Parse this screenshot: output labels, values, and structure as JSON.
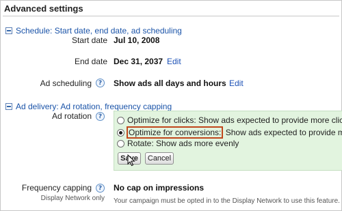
{
  "header": {
    "title": "Advanced settings"
  },
  "schedule": {
    "section_title": "Schedule: Start date, end date, ad scheduling",
    "start_date_label": "Start date",
    "start_date_value": "Jul 10, 2008",
    "end_date_label": "End date",
    "end_date_value": "Dec 31, 2037",
    "end_date_edit": "Edit",
    "ad_scheduling_label": "Ad scheduling",
    "ad_scheduling_value": "Show ads all days and hours",
    "ad_scheduling_edit": "Edit"
  },
  "delivery": {
    "section_title": "Ad delivery: Ad rotation, frequency capping",
    "ad_rotation_label": "Ad rotation",
    "options": [
      {
        "label": "Optimize for clicks:",
        "desc": "Show ads expected to provide more clicks",
        "selected": false
      },
      {
        "label": "Optimize for conversions:",
        "desc": "Show ads expected to provide more",
        "selected": true
      },
      {
        "label": "Rotate: Show ads more evenly",
        "desc": "",
        "selected": false
      }
    ],
    "save_label": "Save",
    "cancel_label": "Cancel",
    "frequency_label": "Frequency capping",
    "frequency_sub_label": "Display Network only",
    "frequency_value": "No cap on impressions",
    "frequency_note": "Your campaign must be opted in to the Display Network to use this feature."
  },
  "icons": {
    "help": "help-question-icon",
    "collapse": "collapse-minus-icon",
    "cursor": "mouse-pointer-icon"
  },
  "colors": {
    "link": "#1a4fb5",
    "panel_bg": "#e2f4df",
    "highlight_border": "#c0461b"
  }
}
